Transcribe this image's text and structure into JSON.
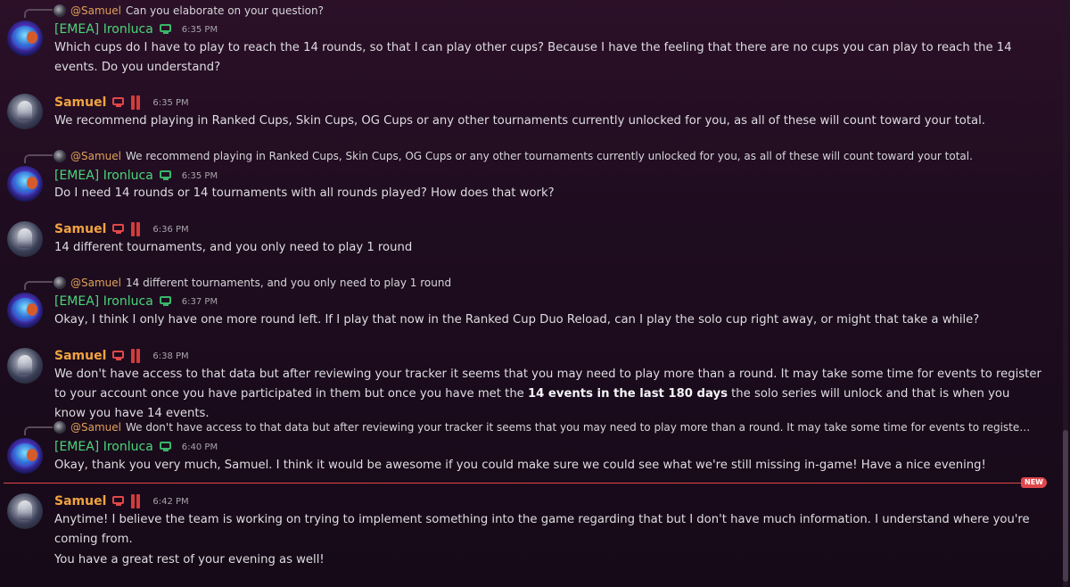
{
  "messages": [
    {
      "reply": {
        "mention": "@Samuel",
        "text": "Can you elaborate on your question?"
      },
      "author": "[EMEA] Ironluca",
      "time": "6:35 PM",
      "text": "Which cups do I have to play to reach the 14 rounds, so that I can play other cups? Because I have the feeling that there are no cups you can play to reach the 14 events. Do you understand?"
    },
    {
      "author": "Samuel",
      "time": "6:35 PM",
      "text": "We recommend playing in Ranked Cups, Skin Cups, OG Cups or any other tournaments currently unlocked for you, as all of these will count toward your total."
    },
    {
      "reply": {
        "mention": "@Samuel",
        "text": "We recommend playing in Ranked Cups, Skin Cups, OG Cups or any other tournaments currently unlocked for you, as all of these will count toward your total."
      },
      "author": "[EMEA] Ironluca",
      "time": "6:35 PM",
      "text": "Do I need 14 rounds or 14 tournaments with all rounds played? How does that work?"
    },
    {
      "author": "Samuel",
      "time": "6:36 PM",
      "text": "14 different tournaments, and you only need to play 1 round"
    },
    {
      "reply": {
        "mention": "@Samuel",
        "text": "14 different tournaments, and you only need to play 1 round"
      },
      "author": "[EMEA] Ironluca",
      "time": "6:37 PM",
      "text": "Okay, I think I only have one more round left. If I play that now in the Ranked Cup Duo Reload, can I play the solo cup right away, or might that take a while?"
    },
    {
      "author": "Samuel",
      "time": "6:38 PM",
      "text_before": "We don't have access to that data but after reviewing your tracker it seems that you may need to play more than a round. It may take some time for events to register to your account once you have participated in them but once you have met the ",
      "text_bold": "14 events in the last 180 days",
      "text_after": " the solo series will unlock and that is when you know you have 14 events."
    },
    {
      "reply": {
        "mention": "@Samuel",
        "text": "We don't have access to that data but after reviewing your tracker it seems that you may need to play more than a round. It may take some time for events to register to your account o..."
      },
      "author": "[EMEA] Ironluca",
      "time": "6:40 PM",
      "text": "Okay, thank you very much, Samuel. I think it would be awesome if you could make sure we could see what we're still missing in-game! Have a nice evening!"
    },
    {
      "author": "Samuel",
      "time": "6:42 PM",
      "text": "Anytime! I believe the team is working on trying to implement something into the game regarding that but I don't have much information. I understand where you're coming from.",
      "text2": "You have a great rest of your evening as well!"
    }
  ],
  "new_label": "NEW",
  "colors": {
    "samuel": "#f1a341",
    "ironluca": "#4ad57a",
    "mention": "#e0a25a",
    "new_divider": "#e0474b"
  },
  "icons": {
    "samuel_badges": [
      "monitor-icon-red",
      "bars-badge-icon"
    ],
    "ironluca_badges": [
      "monitor-icon-green"
    ]
  }
}
